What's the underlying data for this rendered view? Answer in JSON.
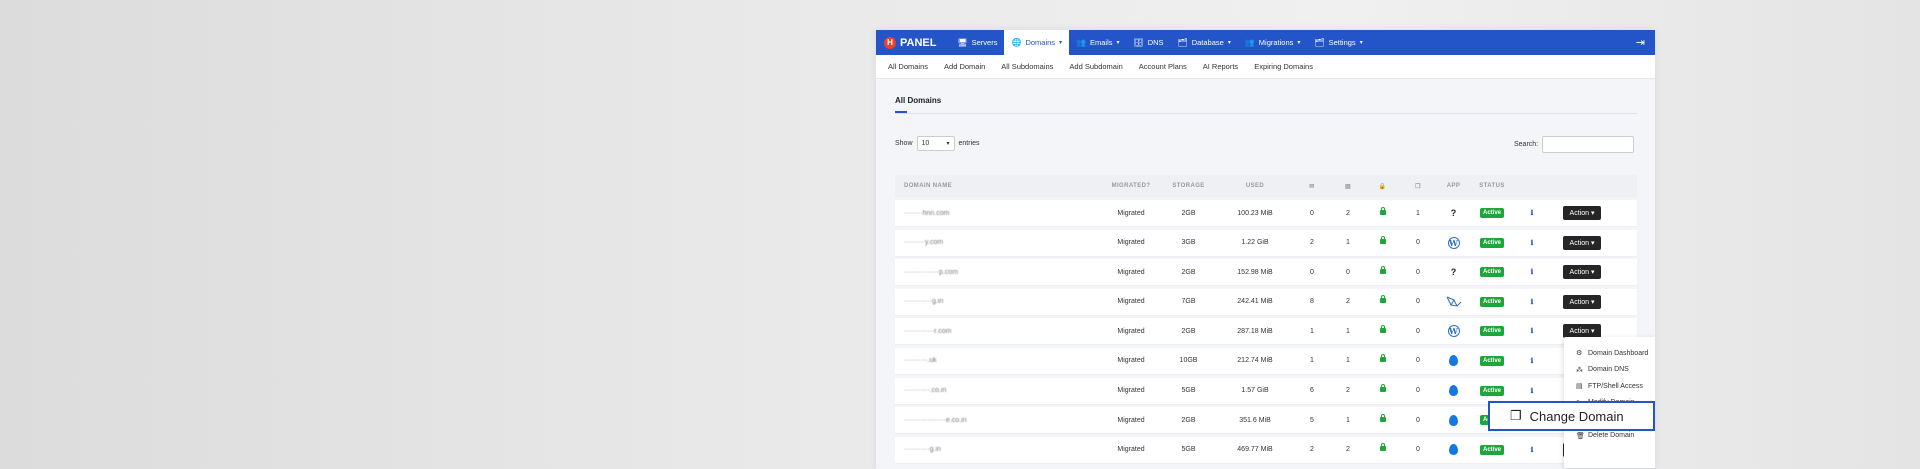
{
  "brand": {
    "badge": "H",
    "name": "PANEL"
  },
  "topnav": [
    {
      "label": "Servers",
      "icon": "🖥",
      "caret": false,
      "active": false
    },
    {
      "label": "Domains",
      "icon": "🌐",
      "caret": true,
      "active": true
    },
    {
      "label": "Emails",
      "icon": "👥",
      "caret": true,
      "active": false
    },
    {
      "label": "DNS",
      "icon": "🗄",
      "caret": false,
      "active": false
    },
    {
      "label": "Database",
      "icon": "🗂",
      "caret": true,
      "active": false
    },
    {
      "label": "Migrations",
      "icon": "👥",
      "caret": true,
      "active": false
    },
    {
      "label": "Settings",
      "icon": "🗂",
      "caret": true,
      "active": false
    }
  ],
  "subnav": [
    "All Domains",
    "Add Domain",
    "All Subdomains",
    "Add Subdomain",
    "Account Plans",
    "AI Reports",
    "Expiring Domains"
  ],
  "section_title": "All Domains",
  "show": {
    "prefix": "Show",
    "value": "10",
    "suffix": "entries"
  },
  "search_label": "Search:",
  "columns": [
    "DOMAIN NAME",
    "MIGRATED?",
    "STORAGE",
    "USED",
    "APP",
    "STATUS"
  ],
  "rows": [
    {
      "name": "········hnn.com",
      "migrated": "Migrated",
      "storage": "2GB",
      "used": "100.23 MiB",
      "emails": "0",
      "dbs": "2",
      "backups": "1",
      "app": "?",
      "status": "Active",
      "action": "Action"
    },
    {
      "name": "·········y.com",
      "migrated": "Migrated",
      "storage": "3GB",
      "used": "1.22 GiB",
      "emails": "2",
      "dbs": "1",
      "backups": "0",
      "app": "W",
      "status": "Active",
      "action": "Action"
    },
    {
      "name": "···············p.com",
      "migrated": "Migrated",
      "storage": "2GB",
      "used": "152.98 MiB",
      "emails": "0",
      "dbs": "0",
      "backups": "0",
      "app": "?",
      "status": "Active",
      "action": "Action"
    },
    {
      "name": "············g.in",
      "migrated": "Migrated",
      "storage": "7GB",
      "used": "242.41 MiB",
      "emails": "8",
      "dbs": "2",
      "backups": "0",
      "app": "L",
      "status": "Active",
      "action": "Action"
    },
    {
      "name": "·············r.com",
      "migrated": "Migrated",
      "storage": "2GB",
      "used": "287.18 MiB",
      "emails": "1",
      "dbs": "1",
      "backups": "0",
      "app": "W",
      "status": "Active",
      "action": "Action"
    },
    {
      "name": "··········.uk",
      "migrated": "Migrated",
      "storage": "10GB",
      "used": "212.74 MiB",
      "emails": "1",
      "dbs": "1",
      "backups": "0",
      "app": "D",
      "status": "Active",
      "action": ""
    },
    {
      "name": "···········.co.in",
      "migrated": "Migrated",
      "storage": "5GB",
      "used": "1.57 GiB",
      "emails": "6",
      "dbs": "2",
      "backups": "0",
      "app": "D",
      "status": "Active",
      "action": ""
    },
    {
      "name": "··················e.co.in",
      "migrated": "Migrated",
      "storage": "2GB",
      "used": "351.6 MiB",
      "emails": "5",
      "dbs": "1",
      "backups": "0",
      "app": "D",
      "status": "Active",
      "action": ""
    },
    {
      "name": "···········g.in",
      "migrated": "Migrated",
      "storage": "5GB",
      "used": "469.77 MiB",
      "emails": "2",
      "dbs": "2",
      "backups": "0",
      "app": "D",
      "status": "Active",
      "action": "Action"
    }
  ],
  "dropdown": [
    {
      "label": "Domain Dashboard",
      "icon": "⚙"
    },
    {
      "label": "Domain DNS",
      "icon": "⁂"
    },
    {
      "label": "FTP/Shell Access",
      "icon": "▤"
    },
    {
      "label": "Modify Domain",
      "icon": "✎"
    },
    {
      "label": "Change Domain",
      "icon": "❐"
    },
    {
      "label": "Delete Domain",
      "icon": "🗑"
    }
  ],
  "zoom": {
    "label": "Change Domain",
    "icon": "❐"
  },
  "colors": {
    "primary": "#2354c8",
    "success": "#1fa63a",
    "dark": "#262626"
  }
}
